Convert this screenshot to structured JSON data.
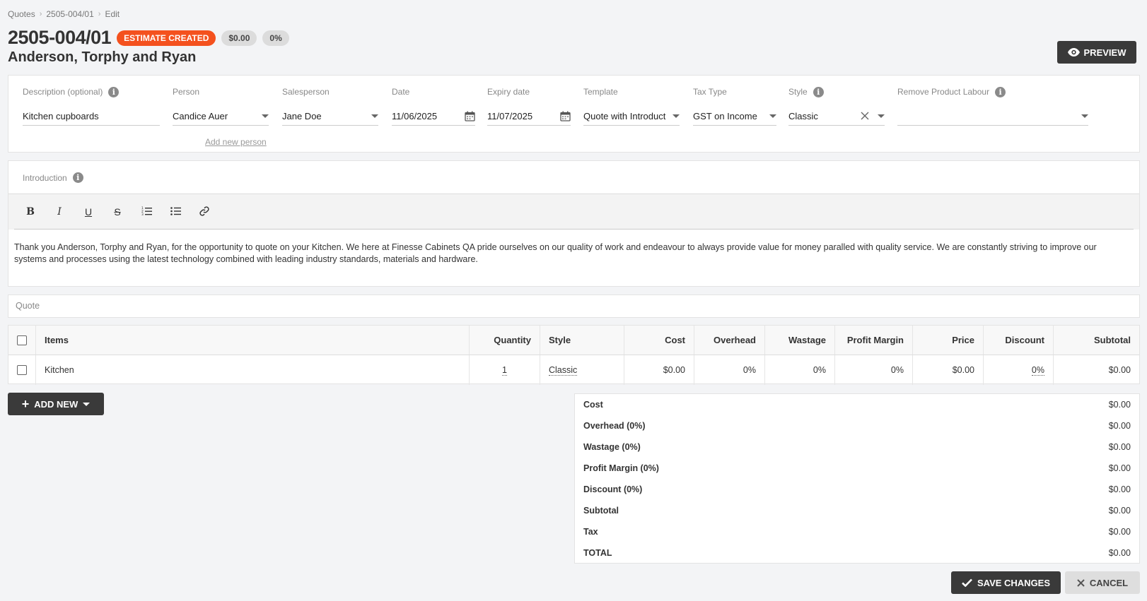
{
  "breadcrumb": [
    "Quotes",
    "2505-004/01",
    "Edit"
  ],
  "quote": {
    "number": "2505-004/01",
    "status": "ESTIMATE CREATED",
    "amount": "$0.00",
    "percent": "0%",
    "client": "Anderson, Torphy and Ryan"
  },
  "preview_label": "PREVIEW",
  "fields": {
    "description": {
      "label": "Description (optional)",
      "value": "Kitchen cupboards"
    },
    "person": {
      "label": "Person",
      "value": "Candice Auer",
      "add_link": "Add new person"
    },
    "salesperson": {
      "label": "Salesperson",
      "value": "Jane Doe"
    },
    "date": {
      "label": "Date",
      "value": "11/06/2025"
    },
    "expiry": {
      "label": "Expiry date",
      "value": "11/07/2025"
    },
    "template": {
      "label": "Template",
      "value": "Quote with Introduct"
    },
    "tax_type": {
      "label": "Tax Type",
      "value": "GST on Income"
    },
    "style": {
      "label": "Style",
      "value": "Classic"
    },
    "remove_labour": {
      "label": "Remove Product Labour",
      "value": ""
    }
  },
  "intro": {
    "label": "Introduction",
    "toolbar": [
      "B",
      "I",
      "U",
      "S",
      "ordered-list",
      "bullet-list",
      "link"
    ],
    "text": "Thank you Anderson, Torphy and Ryan, for the opportunity to quote on your Kitchen. We here at Finesse Cabinets QA pride ourselves on our quality of work and endeavour to always provide value for money paralled with quality service. We are constantly striving to improve our systems and processes using the latest technology combined with leading industry standards, materials and hardware."
  },
  "quote_section_label": "Quote",
  "table": {
    "headers": {
      "items": "Items",
      "quantity": "Quantity",
      "style": "Style",
      "cost": "Cost",
      "overhead": "Overhead",
      "wastage": "Wastage",
      "profit": "Profit Margin",
      "price": "Price",
      "discount": "Discount",
      "subtotal": "Subtotal"
    },
    "rows": [
      {
        "item": "Kitchen",
        "quantity": "1",
        "style": "Classic",
        "cost": "$0.00",
        "overhead": "0%",
        "wastage": "0%",
        "profit": "0%",
        "price": "$0.00",
        "discount": "0%",
        "subtotal": "$0.00"
      }
    ]
  },
  "add_new_label": "ADD NEW",
  "totals": [
    {
      "label": "Cost",
      "value": "$0.00"
    },
    {
      "label": "Overhead (0%)",
      "value": "$0.00"
    },
    {
      "label": "Wastage (0%)",
      "value": "$0.00"
    },
    {
      "label": "Profit Margin (0%)",
      "value": "$0.00"
    },
    {
      "label": "Discount (0%)",
      "value": "$0.00"
    },
    {
      "label": "Subtotal",
      "value": "$0.00"
    },
    {
      "label": "Tax",
      "value": "$0.00"
    },
    {
      "label": "TOTAL",
      "value": "$0.00"
    }
  ],
  "actions": {
    "save": "SAVE CHANGES",
    "cancel": "CANCEL"
  },
  "colors": {
    "status_badge": "#f4511e",
    "dark_button": "#3a3a3a"
  }
}
